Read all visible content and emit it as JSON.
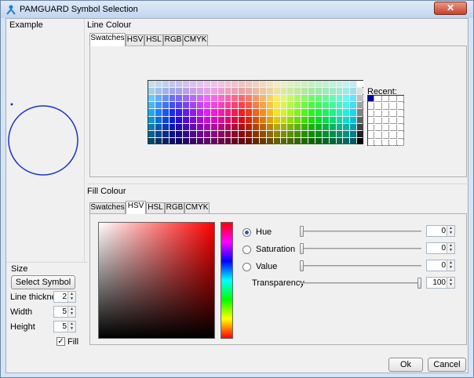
{
  "window": {
    "title": "PAMGUARD Symbol Selection",
    "close_label": "✕"
  },
  "example": {
    "label": "Example",
    "accent": "#1a33cc"
  },
  "size": {
    "label": "Size",
    "select_symbol": "Select Symbol",
    "line_thickness": {
      "label": "Line thickness",
      "value": "2"
    },
    "width": {
      "label": "Width",
      "value": "5"
    },
    "height": {
      "label": "Height",
      "value": "5"
    },
    "fill": {
      "label": "Fill",
      "checked": true
    }
  },
  "line_colour": {
    "label": "Line Colour",
    "tabs": [
      "Swatches",
      "HSV",
      "HSL",
      "RGB",
      "CMYK"
    ],
    "active_tab": "Swatches",
    "recent_label": "Recent:",
    "recent_first": "#0000a0"
  },
  "fill_colour": {
    "label": "Fill Colour",
    "tabs": [
      "Swatches",
      "HSV",
      "HSL",
      "RGB",
      "CMYK"
    ],
    "active_tab": "HSV",
    "hue": {
      "label": "Hue",
      "value": "0",
      "selected": true
    },
    "saturation": {
      "label": "Saturation",
      "value": "0"
    },
    "value": {
      "label": "Value",
      "value": "0"
    },
    "transparency": {
      "label": "Transparency",
      "value": "100"
    }
  },
  "footer": {
    "ok": "Ok",
    "cancel": "Cancel"
  }
}
